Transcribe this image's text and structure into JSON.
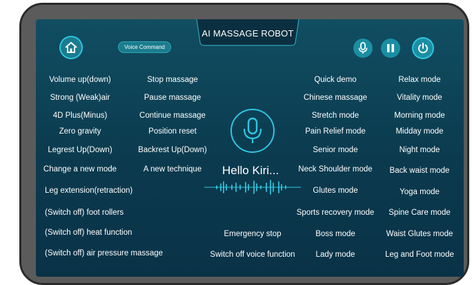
{
  "header": {
    "title": "AI MASSAGE ROBOT",
    "voice_command_label": "Voice Command"
  },
  "colors": {
    "screen_bg": "#0b3a4e",
    "accent": "#2fc6e0",
    "button_bg": "#1a7c8e"
  },
  "icons": {
    "home": "home-icon",
    "mic": "microphone-icon",
    "pause": "pause-icon",
    "power": "power-icon"
  },
  "commands": {
    "col1": [
      "Volume up(down)",
      "Strong (Weak)air",
      "4D Plus(Minus)",
      "Zero gravity",
      "Legrest Up(Down)",
      "Change a new mode"
    ],
    "col2": [
      "Stop massage",
      "Pause massage",
      "Continue massage",
      "Position reset",
      "Backrest Up(Down)",
      "A new technique"
    ],
    "left_long": [
      "Leg extension(retraction)",
      "(Switch off) foot rollers",
      "(Switch off) heat function",
      "(Switch off) air pressure massage"
    ],
    "center_bottom": [
      "Emergency stop",
      "Switch off voice function"
    ],
    "col3": [
      "Quick demo",
      "Chinese massage",
      "Stretch mode",
      "Pain Relief mode",
      "Senior mode",
      "Neck Shoulder mode",
      "Glutes mode",
      "Sports recovery mode",
      "Boss mode",
      "Lady mode"
    ],
    "col4": [
      "Relax mode",
      "Vitality mode",
      "Morning mode",
      "Midday mode",
      "Night mode",
      "Back waist mode",
      "Yoga mode",
      "Spine Care mode",
      "Waist Glutes mode",
      "Leg and Foot mode"
    ]
  },
  "assistant": {
    "greeting": "Hello Kiri..."
  }
}
